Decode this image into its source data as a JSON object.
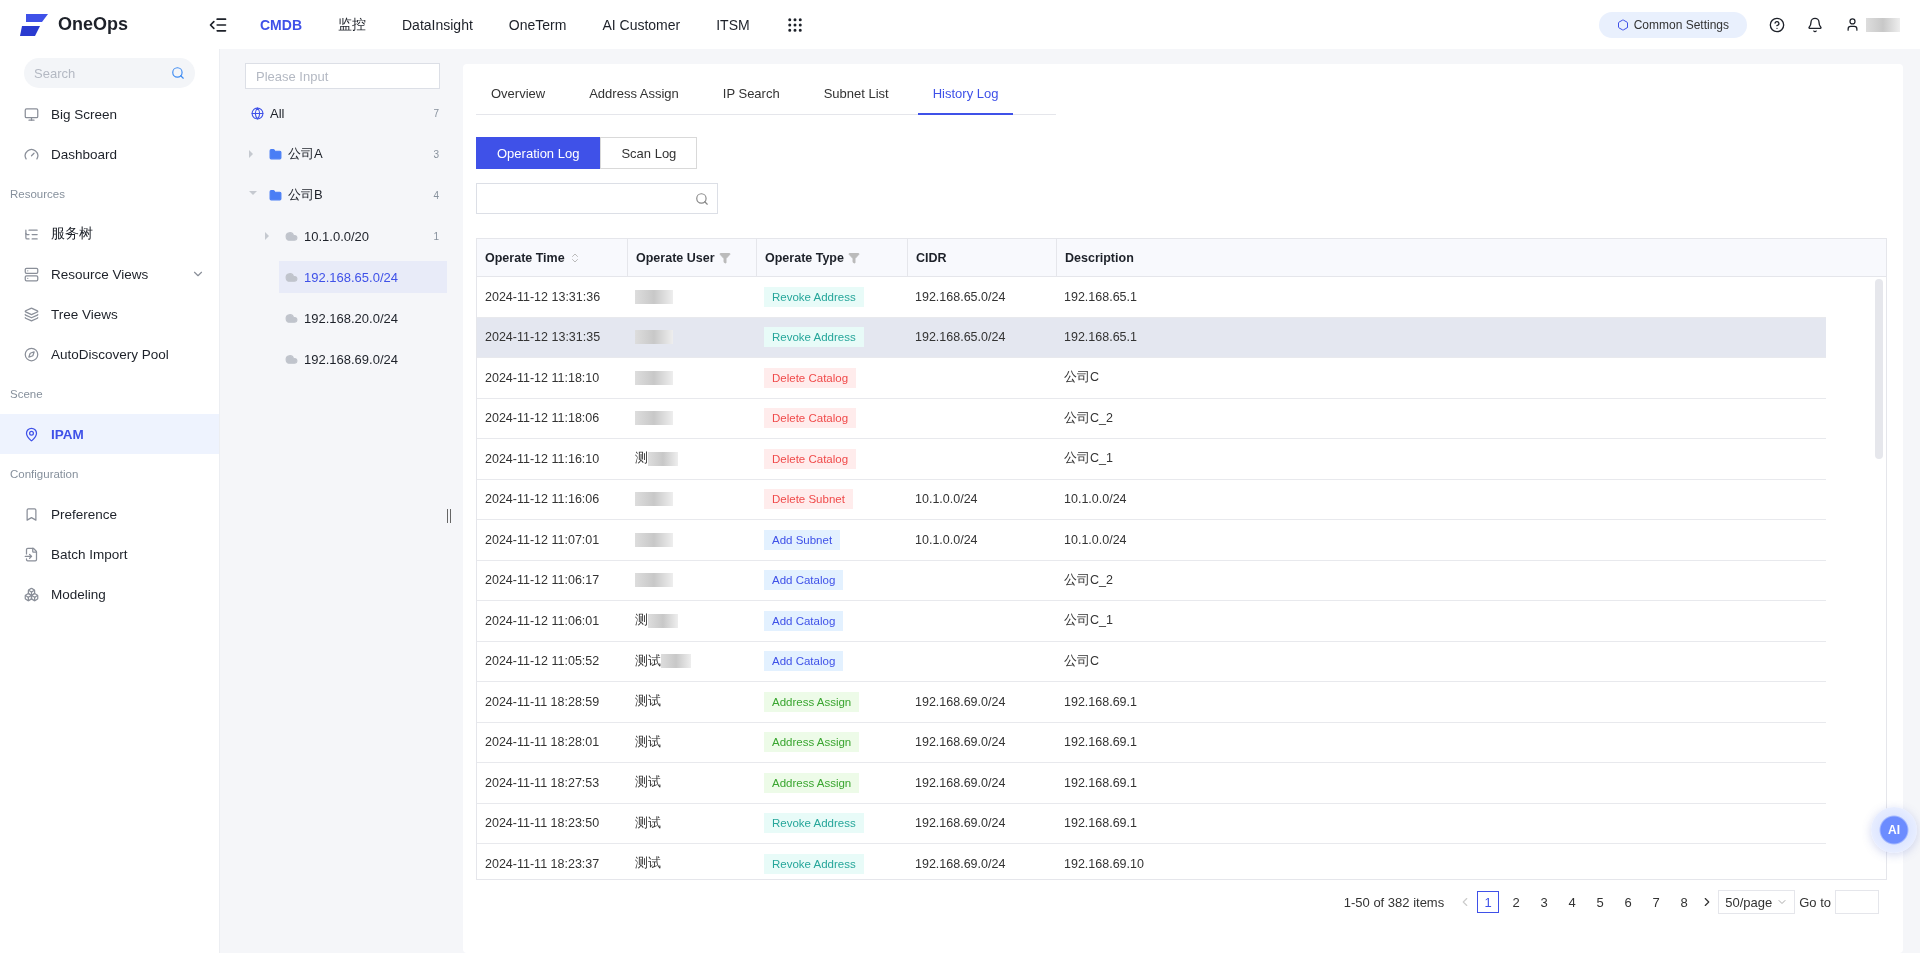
{
  "topbar": {
    "brand": "OneOps",
    "nav": [
      {
        "label": "CMDB",
        "selected": true
      },
      {
        "label": "监控",
        "selected": false
      },
      {
        "label": "DataInsight",
        "selected": false
      },
      {
        "label": "OneTerm",
        "selected": false
      },
      {
        "label": "AI Customer",
        "selected": false
      },
      {
        "label": "ITSM",
        "selected": false
      }
    ],
    "settings_button": "Common Settings"
  },
  "sidebar": {
    "search": {
      "placeholder": "Search"
    },
    "items": [
      {
        "kind": "item",
        "label": "Big Screen",
        "selected": false
      },
      {
        "kind": "item",
        "label": "Dashboard",
        "selected": false
      },
      {
        "kind": "section",
        "label": "Resources"
      },
      {
        "kind": "item",
        "label": "服务树",
        "selected": false
      },
      {
        "kind": "item",
        "label": "Resource Views",
        "selected": false,
        "expandable": true
      },
      {
        "kind": "item",
        "label": "Tree Views",
        "selected": false
      },
      {
        "kind": "item",
        "label": "AutoDiscovery Pool",
        "selected": false
      },
      {
        "kind": "section",
        "label": "Scene"
      },
      {
        "kind": "item",
        "label": "IPAM",
        "selected": true
      },
      {
        "kind": "section",
        "label": "Configuration"
      },
      {
        "kind": "item",
        "label": "Preference",
        "selected": false
      },
      {
        "kind": "item",
        "label": "Batch Import",
        "selected": false
      },
      {
        "kind": "item",
        "label": "Modeling",
        "selected": false
      }
    ]
  },
  "tree": {
    "search": {
      "placeholder": "Please Input"
    },
    "nodes": [
      {
        "kind": "all",
        "label": "All",
        "count": "7",
        "selected": false,
        "children": [
          {
            "kind": "folder",
            "label": "公司A",
            "count": "3",
            "expanded": false,
            "selected": false
          },
          {
            "kind": "folder",
            "label": "公司B",
            "count": "4",
            "expanded": true,
            "selected": false,
            "children": [
              {
                "kind": "subnet",
                "label": "10.1.0.0/20",
                "count": "1",
                "expanded": false,
                "selected": false
              },
              {
                "kind": "subnet",
                "label": "192.168.65.0/24",
                "selected": true
              },
              {
                "kind": "subnet",
                "label": "192.168.20.0/24",
                "selected": false
              },
              {
                "kind": "subnet",
                "label": "192.168.69.0/24",
                "selected": false
              }
            ]
          }
        ]
      }
    ]
  },
  "tabs": [
    {
      "label": "Overview",
      "selected": false
    },
    {
      "label": "Address Assign",
      "selected": false
    },
    {
      "label": "IP Search",
      "selected": false
    },
    {
      "label": "Subnet List",
      "selected": false
    },
    {
      "label": "History Log",
      "selected": true
    }
  ],
  "log_switch": [
    {
      "label": "Operation Log",
      "selected": true
    },
    {
      "label": "Scan Log",
      "selected": false
    }
  ],
  "table": {
    "columns": [
      "Operate Time",
      "Operate User",
      "Operate Type",
      "CIDR",
      "Description"
    ],
    "rows": [
      {
        "time": "2024-11-12 13:31:36",
        "redacted": true,
        "type": {
          "kind": "revoke",
          "label": "Revoke Address"
        },
        "cidr": "192.168.65.0/24",
        "description": "192.168.65.1",
        "selected": false
      },
      {
        "time": "2024-11-12 13:31:35",
        "redacted": true,
        "type": {
          "kind": "revoke",
          "label": "Revoke Address"
        },
        "cidr": "192.168.65.0/24",
        "description": "192.168.65.1",
        "selected": true
      },
      {
        "time": "2024-11-12 11:18:10",
        "redacted": true,
        "type": {
          "kind": "delete",
          "label": "Delete Catalog"
        },
        "description": "公司C",
        "selected": false
      },
      {
        "time": "2024-11-12 11:18:06",
        "redacted": true,
        "type": {
          "kind": "delete",
          "label": "Delete Catalog"
        },
        "description": "公司C_2",
        "selected": false
      },
      {
        "time": "2024-11-12 11:16:10",
        "user": "测",
        "redacted": true,
        "type": {
          "kind": "delete",
          "label": "Delete Catalog"
        },
        "description": "公司C_1",
        "selected": false
      },
      {
        "time": "2024-11-12 11:16:06",
        "redacted": true,
        "type": {
          "kind": "delete",
          "label": "Delete Subnet"
        },
        "cidr": "10.1.0.0/24",
        "description": "10.1.0.0/24",
        "selected": false
      },
      {
        "time": "2024-11-12 11:07:01",
        "redacted": true,
        "type": {
          "kind": "add",
          "label": "Add Subnet"
        },
        "cidr": "10.1.0.0/24",
        "description": "10.1.0.0/24",
        "selected": false
      },
      {
        "time": "2024-11-12 11:06:17",
        "redacted": true,
        "type": {
          "kind": "add",
          "label": "Add Catalog"
        },
        "description": "公司C_2",
        "selected": false
      },
      {
        "time": "2024-11-12 11:06:01",
        "user": "测",
        "redacted": true,
        "type": {
          "kind": "add",
          "label": "Add Catalog"
        },
        "description": "公司C_1",
        "selected": false
      },
      {
        "time": "2024-11-12 11:05:52",
        "user": "测试",
        "redacted": true,
        "type": {
          "kind": "add",
          "label": "Add Catalog"
        },
        "description": "公司C",
        "selected": false
      },
      {
        "time": "2024-11-11 18:28:59",
        "user": "测试",
        "redacted": false,
        "type": {
          "kind": "assign",
          "label": "Address Assign"
        },
        "cidr": "192.168.69.0/24",
        "description": "192.168.69.1",
        "selected": false
      },
      {
        "time": "2024-11-11 18:28:01",
        "user": "测试",
        "redacted": false,
        "type": {
          "kind": "assign",
          "label": "Address Assign"
        },
        "cidr": "192.168.69.0/24",
        "description": "192.168.69.1",
        "selected": false
      },
      {
        "time": "2024-11-11 18:27:53",
        "user": "测试",
        "redacted": false,
        "type": {
          "kind": "assign",
          "label": "Address Assign"
        },
        "cidr": "192.168.69.0/24",
        "description": "192.168.69.1",
        "selected": false
      },
      {
        "time": "2024-11-11 18:23:50",
        "user": "测试",
        "redacted": false,
        "type": {
          "kind": "revoke",
          "label": "Revoke Address"
        },
        "cidr": "192.168.69.0/24",
        "description": "192.168.69.1",
        "selected": false
      },
      {
        "time": "2024-11-11 18:23:37",
        "user": "测试",
        "redacted": false,
        "type": {
          "kind": "revoke",
          "label": "Revoke Address"
        },
        "cidr": "192.168.69.0/24",
        "description": "192.168.69.10",
        "selected": false
      }
    ]
  },
  "pagination": {
    "summary": "1-50 of 382 items",
    "pages": [
      {
        "label": "1",
        "selected": true
      },
      {
        "label": "2",
        "selected": false
      },
      {
        "label": "3",
        "selected": false
      },
      {
        "label": "4",
        "selected": false
      },
      {
        "label": "5",
        "selected": false
      },
      {
        "label": "6",
        "selected": false
      },
      {
        "label": "7",
        "selected": false
      },
      {
        "label": "8",
        "selected": false
      }
    ],
    "page_size": "50/page",
    "goto_label": "Go to"
  },
  "ai_button": "AI"
}
